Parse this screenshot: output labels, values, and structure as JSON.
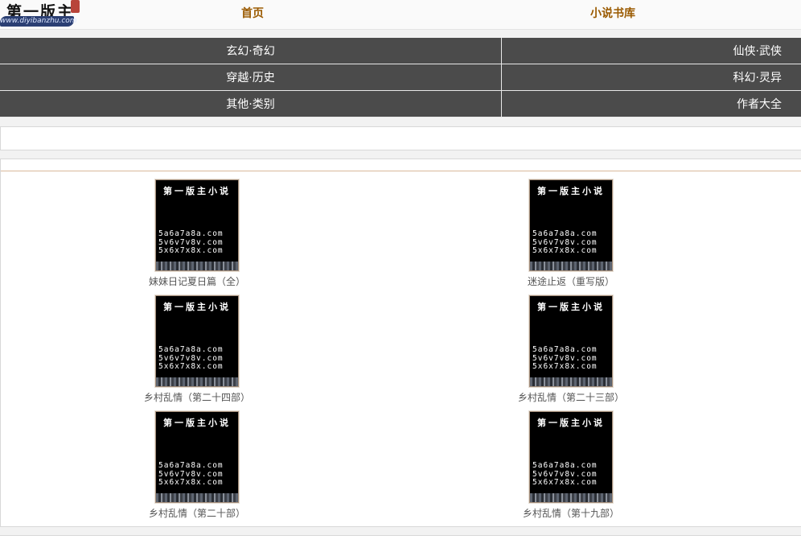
{
  "header": {
    "logo_text": "第一版主",
    "logo_sub": "www.diyibanzhu.com",
    "nav": [
      {
        "label": "首页"
      },
      {
        "label": "小说书库"
      }
    ]
  },
  "categories": {
    "rows": [
      {
        "left": "玄幻·奇幻",
        "right": "仙侠·武侠"
      },
      {
        "left": "穿越·历史",
        "right": "科幻·灵异"
      },
      {
        "left": "其他·类别",
        "right": "作者大全"
      }
    ]
  },
  "cover": {
    "title": "第一版主小说",
    "urls": [
      "5a6a7a8a.com",
      "5v6v7v8v.com",
      "5x6x7x8x.com"
    ]
  },
  "books": [
    {
      "title": "妹妹日记夏日篇（全）"
    },
    {
      "title": "迷途止返（重写版）"
    },
    {
      "title": "乡村乱情（第二十四部）"
    },
    {
      "title": "乡村乱情（第二十三部）"
    },
    {
      "title": "乡村乱情（第二十部）"
    },
    {
      "title": "乡村乱情（第十九部）"
    }
  ],
  "colors": {
    "nav_link": "#9a5a00",
    "category_bg": "#4b4b4b",
    "panel_rule": "#d9b99a"
  }
}
